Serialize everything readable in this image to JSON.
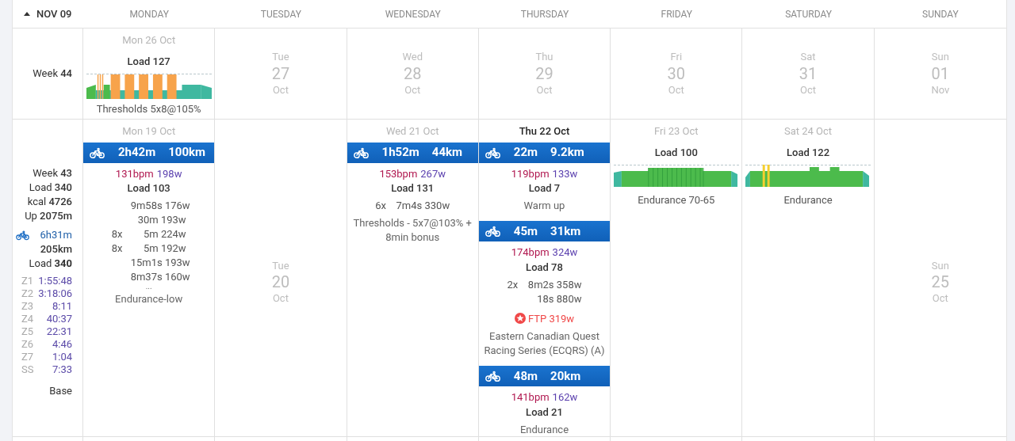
{
  "header": {
    "title": "NOV 09",
    "days": [
      "MONDAY",
      "TUESDAY",
      "WEDNESDAY",
      "THURSDAY",
      "FRIDAY",
      "SATURDAY",
      "SUNDAY"
    ]
  },
  "weeks": [
    {
      "summary": {
        "lines": [
          "Week **44**"
        ]
      },
      "days": [
        {
          "kind": "planned",
          "date": "Mon 26 Oct",
          "load": "Load 127",
          "profile": {
            "kind": "thresholds"
          },
          "name": "Thresholds 5x8@105%"
        },
        {
          "kind": "empty",
          "weekday": "Tue",
          "day": "27",
          "month": "Oct"
        },
        {
          "kind": "empty",
          "weekday": "Wed",
          "day": "28",
          "month": "Oct"
        },
        {
          "kind": "empty",
          "weekday": "Thu",
          "day": "29",
          "month": "Oct"
        },
        {
          "kind": "empty",
          "weekday": "Fri",
          "day": "30",
          "month": "Oct"
        },
        {
          "kind": "empty",
          "weekday": "Sat",
          "day": "31",
          "month": "Oct"
        },
        {
          "kind": "empty",
          "weekday": "Sun",
          "day": "01",
          "month": "Nov"
        }
      ]
    },
    {
      "summary": {
        "lines": [
          "Week **43**",
          "Load **340**",
          "kcal **4726**",
          "Up **2075m**"
        ],
        "ride": {
          "duration": "6h31m",
          "distance": "205km",
          "load": "Load **340**"
        },
        "zones": [
          {
            "zone": "Z1",
            "time": "1:55:48"
          },
          {
            "zone": "Z2",
            "time": "3:18:06"
          },
          {
            "zone": "Z3",
            "time": "8:11"
          },
          {
            "zone": "Z4",
            "time": "40:37"
          },
          {
            "zone": "Z5",
            "time": "22:31"
          },
          {
            "zone": "Z6",
            "time": "4:46"
          },
          {
            "zone": "Z7",
            "time": "1:04"
          },
          {
            "zone": "SS",
            "time": "7:33"
          }
        ],
        "phase": "Base"
      },
      "days": [
        {
          "kind": "activities",
          "date": "Mon 19 Oct",
          "today": false,
          "activities": [
            {
              "duration": "2h42m",
              "distance": "100km",
              "hr": "131bpm",
              "power": "198w",
              "load": "Load 103",
              "intervals": [
                {
                  "text": "9m58s 176w"
                },
                {
                  "text": "30m 193w"
                },
                {
                  "reps": "8x",
                  "text": "5m 224w"
                },
                {
                  "reps": "8x",
                  "text": "5m 192w"
                },
                {
                  "text": "15m1s 193w"
                },
                {
                  "text": "8m37s 160w"
                }
              ],
              "more": "...",
              "name": "Endurance-low"
            }
          ]
        },
        {
          "kind": "empty",
          "weekday": "Tue",
          "day": "20",
          "month": "Oct"
        },
        {
          "kind": "activities",
          "date": "Wed 21 Oct",
          "today": false,
          "activities": [
            {
              "duration": "1h52m",
              "distance": "44km",
              "hr": "153bpm",
              "power": "267w",
              "load": "Load 131",
              "intervals": [
                {
                  "reps": "6x",
                  "text": "7m4s 330w"
                }
              ],
              "name": "Thresholds - 5x7@103% + 8min bonus"
            }
          ]
        },
        {
          "kind": "activities",
          "date": "Thu 22 Oct",
          "today": true,
          "activities": [
            {
              "duration": "22m",
              "distance": "9.2km",
              "hr": "119bpm",
              "power": "133w",
              "load": "Load 7",
              "name": "Warm up"
            },
            {
              "duration": "45m",
              "distance": "31km",
              "hr": "174bpm",
              "power": "324w",
              "load": "Load 78",
              "intervals": [
                {
                  "reps": "2x",
                  "text": "8m2s 358w"
                },
                {
                  "text": "18s 880w"
                }
              ],
              "achievement": "FTP 319w",
              "name": "Eastern Canadian Quest Racing Series (ECQRS) (A)"
            },
            {
              "duration": "48m",
              "distance": "20km",
              "hr": "141bpm",
              "power": "162w",
              "load": "Load 21",
              "name": "Endurance"
            }
          ]
        },
        {
          "kind": "planned",
          "date": "Fri 23 Oct",
          "load": "Load 100",
          "profile": {
            "kind": "endurance"
          },
          "name": "Endurance 70-65"
        },
        {
          "kind": "planned",
          "date": "Sat 24 Oct",
          "load": "Load 122",
          "profile": {
            "kind": "openers"
          },
          "name": "Endurance"
        },
        {
          "kind": "empty",
          "weekday": "Sun",
          "day": "25",
          "month": "Oct"
        }
      ]
    }
  ]
}
